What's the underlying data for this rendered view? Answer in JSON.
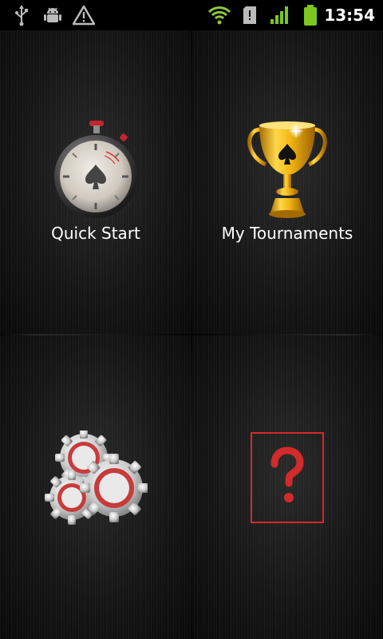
{
  "status_bar": {
    "time": "13:54",
    "icons": [
      "usb-icon",
      "android-debug-icon",
      "warning-icon",
      "wifi-icon",
      "sd-card-icon",
      "signal-icon",
      "battery-icon"
    ]
  },
  "menu": {
    "tiles": [
      {
        "label": "Quick Start",
        "icon": "stopwatch-icon"
      },
      {
        "label": "My Tournaments",
        "icon": "trophy-icon"
      },
      {
        "label": "",
        "icon": "gears-icon"
      },
      {
        "label": "",
        "icon": "help-question-icon"
      }
    ]
  },
  "colors": {
    "status_bar_bg": "#000000",
    "battery_green": "#7cc620",
    "trophy_gold": "#f2b81a",
    "help_red": "#d12b2b"
  }
}
